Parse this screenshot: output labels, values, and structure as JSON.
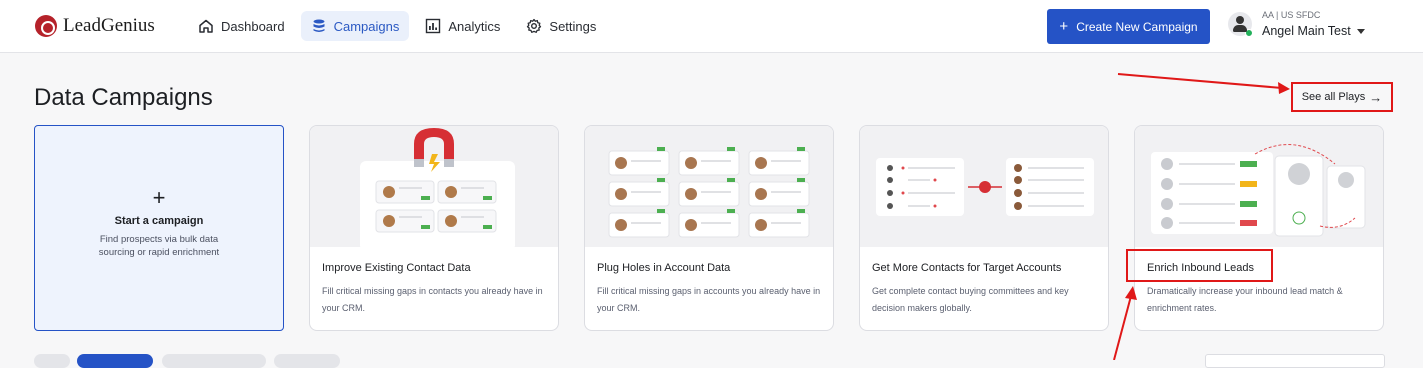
{
  "app": {
    "name": "LeadGenius"
  },
  "nav": {
    "items": [
      {
        "label": "Dashboard",
        "icon": "home-icon",
        "active": false
      },
      {
        "label": "Campaigns",
        "icon": "database-icon",
        "active": true
      },
      {
        "label": "Analytics",
        "icon": "bar-chart-icon",
        "active": false
      },
      {
        "label": "Settings",
        "icon": "gear-icon",
        "active": false
      }
    ]
  },
  "header": {
    "create_button_label": "Create New Campaign",
    "create_button_icon": "plus-icon",
    "user_org": "AA | US SFDC",
    "user_name": "Angel Main Test"
  },
  "page": {
    "title": "Data Campaigns",
    "see_all_label": "See all Plays"
  },
  "start_card": {
    "icon": "plus-icon",
    "title": "Start a campaign",
    "description": "Find prospects via bulk data sourcing or rapid enrichment"
  },
  "plays": [
    {
      "title": "Improve Existing Contact Data",
      "description": "Fill critical missing gaps in contacts you already have in your CRM."
    },
    {
      "title": "Plug Holes in Account Data",
      "description": "Fill critical missing gaps in accounts you already have in your CRM."
    },
    {
      "title": "Get More Contacts for Target Accounts",
      "description": "Get complete contact buying committees and key decision makers globally."
    },
    {
      "title": "Enrich Inbound Leads",
      "description": "Dramatically increase your inbound lead match & enrichment rates."
    }
  ],
  "colors": {
    "primary": "#2553c6",
    "brand": "#b5222a",
    "annotation": "#e01818",
    "active_nav_bg": "#eaf0fb"
  }
}
